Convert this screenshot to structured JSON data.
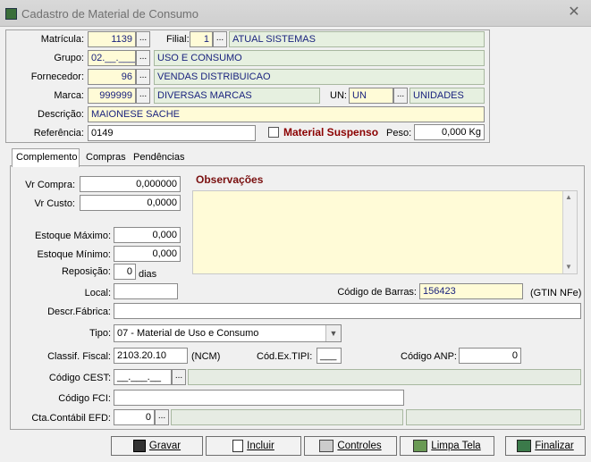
{
  "window": {
    "title": "Cadastro de Material de Consumo",
    "close_glyph": "✕"
  },
  "header": {
    "matricula_label": "Matrícula:",
    "matricula_value": "1139",
    "filial_label": "Filial:",
    "filial_value": "1",
    "filial_name": "ATUAL SISTEMAS",
    "grupo_label": "Grupo:",
    "grupo_value": "02.__.___",
    "grupo_name": "USO E CONSUMO",
    "fornecedor_label": "Fornecedor:",
    "fornecedor_value": "96",
    "fornecedor_name": "VENDAS DISTRIBUICAO",
    "marca_label": "Marca:",
    "marca_value": "999999",
    "marca_name": "DIVERSAS MARCAS",
    "un_label": "UN:",
    "un_value": "UN",
    "un_name": "UNIDADES",
    "descricao_label": "Descrição:",
    "descricao_value": "MAIONESE SACHE",
    "referencia_label": "Referência:",
    "referencia_value": "0149",
    "suspenso_label": "Material Suspenso",
    "peso_label": "Peso:",
    "peso_value": "0,000 Kg"
  },
  "tabs": [
    {
      "label": "Complemento"
    },
    {
      "label": "Compras"
    },
    {
      "label": "Pendências"
    }
  ],
  "complemento": {
    "vr_compra_label": "Vr Compra:",
    "vr_compra_value": "0,000000",
    "vr_custo_label": "Vr Custo:",
    "vr_custo_value": "0,0000",
    "observacoes_label": "Observações",
    "estoque_max_label": "Estoque Máximo:",
    "estoque_max_value": "0,000",
    "estoque_min_label": "Estoque Mínimo:",
    "estoque_min_value": "0,000",
    "reposicao_label": "Reposição:",
    "reposicao_value": "0",
    "reposicao_unit": "dias",
    "local_label": "Local:",
    "local_value": "",
    "codigo_barras_label": "Código de Barras:",
    "codigo_barras_value": "156423",
    "gtin_label": "(GTIN NFe)",
    "descr_fabrica_label": "Descr.Fábrica:",
    "descr_fabrica_value": "",
    "tipo_label": "Tipo:",
    "tipo_value": "07 - Material de Uso e Consumo",
    "classif_fiscal_label": "Classif. Fiscal:",
    "classif_fiscal_value": "2103.20.10",
    "ncm_label": "(NCM)",
    "cod_ex_tipi_label": "Cód.Ex.TIPI:",
    "cod_ex_tipi_value": "___",
    "codigo_anp_label": "Código ANP:",
    "codigo_anp_value": "0",
    "codigo_cest_label": "Código CEST:",
    "codigo_cest_value": "__.___.__",
    "codigo_fci_label": "Código FCI:",
    "codigo_fci_value": "",
    "cta_contabil_label": "Cta.Contábil EFD:",
    "cta_contabil_value": "0"
  },
  "toolbar": {
    "gravar": "Gravar",
    "incluir": "Incluir",
    "controles": "Controles",
    "limpa_tela": "Limpa Tela",
    "finalizar": "Finalizar"
  },
  "ellipsis": "..."
}
